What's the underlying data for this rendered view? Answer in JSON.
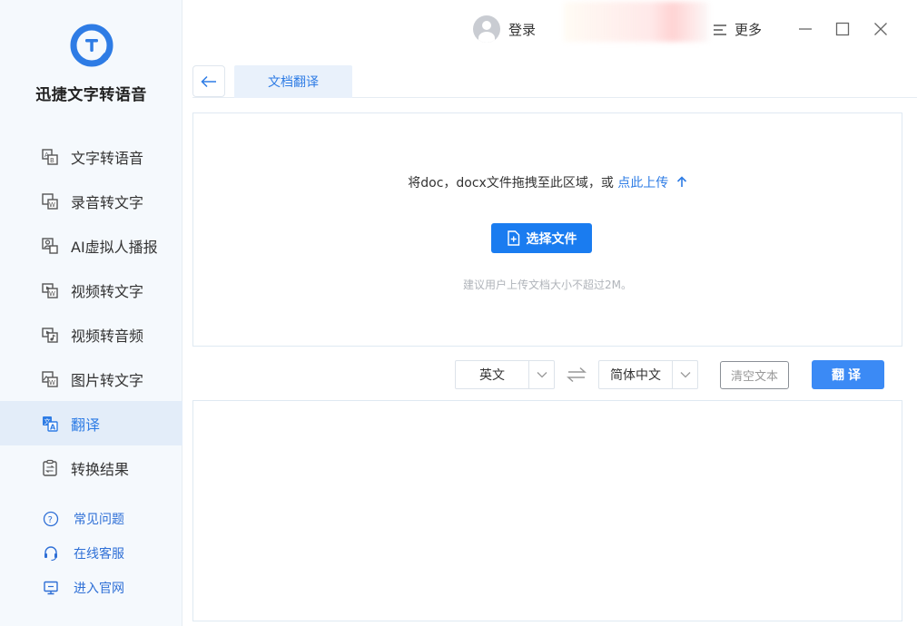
{
  "app": {
    "title": "迅捷文字转语音"
  },
  "sidebar": {
    "items": [
      {
        "label": "文字转语音",
        "icon": "text-to-speech-icon"
      },
      {
        "label": "录音转文字",
        "icon": "audio-to-text-icon"
      },
      {
        "label": "AI虚拟人播报",
        "icon": "ai-avatar-icon"
      },
      {
        "label": "视频转文字",
        "icon": "video-to-text-icon"
      },
      {
        "label": "视频转音频",
        "icon": "video-to-audio-icon"
      },
      {
        "label": "图片转文字",
        "icon": "image-to-text-icon"
      },
      {
        "label": "翻译",
        "icon": "translate-icon",
        "active": true
      },
      {
        "label": "转换结果",
        "icon": "results-icon"
      }
    ],
    "links": [
      {
        "label": "常见问题",
        "icon": "question-icon"
      },
      {
        "label": "在线客服",
        "icon": "headset-icon"
      },
      {
        "label": "进入官网",
        "icon": "monitor-icon"
      }
    ]
  },
  "header": {
    "login_label": "登录",
    "more_label": "更多"
  },
  "tabs": [
    {
      "label": "文档翻译",
      "active": true
    }
  ],
  "upload": {
    "hint_text": "将doc，docx文件拖拽至此区域，或",
    "hint_link": "点此上传",
    "select_button": "选择文件",
    "size_hint": "建议用户上传文档大小不超过2M。"
  },
  "controls": {
    "source_language": "英文",
    "target_language": "简体中文",
    "clear_label": "清空文本",
    "translate_label": "翻译"
  },
  "colors": {
    "accent": "#1a7cf0",
    "sidebar_bg": "#f5f9fd",
    "active_bg": "#e3edf9"
  }
}
